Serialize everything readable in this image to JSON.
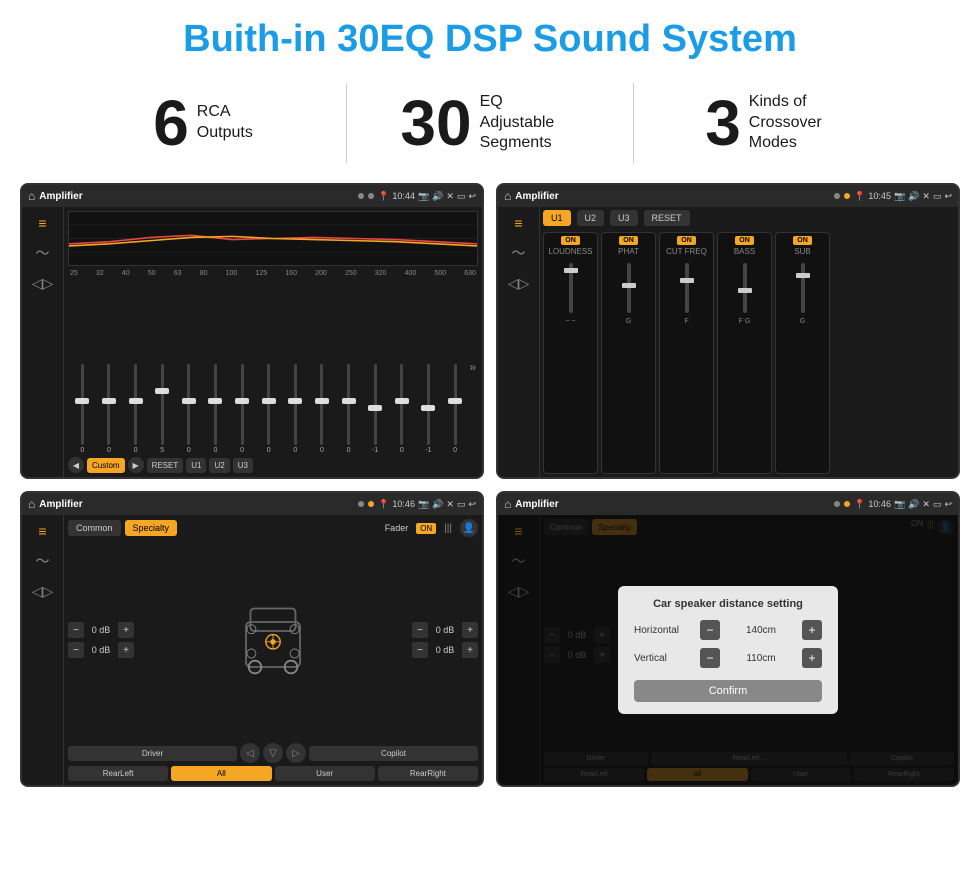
{
  "page": {
    "title": "Buith-in 30EQ DSP Sound System"
  },
  "stats": [
    {
      "number": "6",
      "text": "RCA\nOutputs"
    },
    {
      "number": "30",
      "text": "EQ Adjustable\nSegments"
    },
    {
      "number": "3",
      "text": "Kinds of\nCrossover Modes"
    }
  ],
  "screen1": {
    "status": {
      "app": "Amplifier",
      "time": "10:44"
    },
    "eq_freqs": [
      "25",
      "32",
      "40",
      "50",
      "63",
      "80",
      "100",
      "125",
      "160",
      "200",
      "250",
      "320",
      "400",
      "500",
      "630"
    ],
    "eq_values": [
      "0",
      "0",
      "0",
      "5",
      "0",
      "0",
      "0",
      "0",
      "0",
      "0",
      "0",
      "-1",
      "0",
      "-1"
    ],
    "buttons": [
      "Custom",
      "RESET",
      "U1",
      "U2",
      "U3"
    ]
  },
  "screen2": {
    "status": {
      "app": "Amplifier",
      "time": "10:45"
    },
    "presets": [
      "U1",
      "U2",
      "U3"
    ],
    "channels": [
      "LOUDNESS",
      "PHAT",
      "CUT FREQ",
      "BASS",
      "SUB"
    ]
  },
  "screen3": {
    "status": {
      "app": "Amplifier",
      "time": "10:46"
    },
    "tabs": [
      "Common",
      "Specialty"
    ],
    "active_tab": "Specialty",
    "fader": "Fader",
    "fader_on": "ON",
    "db_values": [
      "0 dB",
      "0 dB",
      "0 dB",
      "0 dB"
    ],
    "bottom_buttons": [
      "Driver",
      "RearLeft",
      "All",
      "User",
      "RearRight",
      "Copilot"
    ]
  },
  "screen4": {
    "status": {
      "app": "Amplifier",
      "time": "10:46"
    },
    "tabs": [
      "Common",
      "Specialty"
    ],
    "dialog": {
      "title": "Car speaker distance setting",
      "horizontal_label": "Horizontal",
      "horizontal_value": "140cm",
      "vertical_label": "Vertical",
      "vertical_value": "110cm",
      "confirm_label": "Confirm"
    },
    "bottom_buttons": [
      "Driver",
      "RearLeft",
      "All",
      "User",
      "RearRight",
      "Copilot"
    ]
  }
}
